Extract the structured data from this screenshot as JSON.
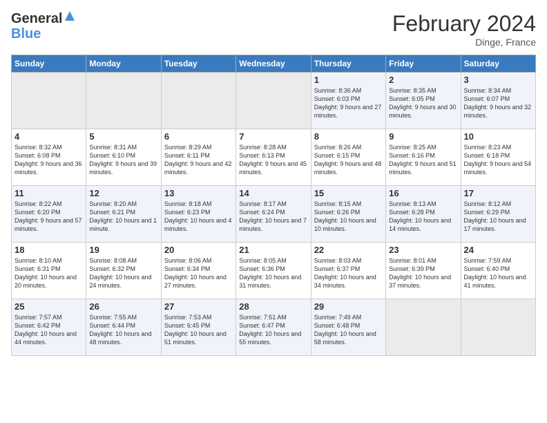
{
  "header": {
    "logo_line1": "General",
    "logo_line2": "Blue",
    "title": "February 2024",
    "subtitle": "Dinge, France"
  },
  "weekdays": [
    "Sunday",
    "Monday",
    "Tuesday",
    "Wednesday",
    "Thursday",
    "Friday",
    "Saturday"
  ],
  "weeks": [
    [
      {
        "day": "",
        "info": ""
      },
      {
        "day": "",
        "info": ""
      },
      {
        "day": "",
        "info": ""
      },
      {
        "day": "",
        "info": ""
      },
      {
        "day": "1",
        "info": "Sunrise: 8:36 AM\nSunset: 6:03 PM\nDaylight: 9 hours and 27 minutes."
      },
      {
        "day": "2",
        "info": "Sunrise: 8:35 AM\nSunset: 6:05 PM\nDaylight: 9 hours and 30 minutes."
      },
      {
        "day": "3",
        "info": "Sunrise: 8:34 AM\nSunset: 6:07 PM\nDaylight: 9 hours and 32 minutes."
      }
    ],
    [
      {
        "day": "4",
        "info": "Sunrise: 8:32 AM\nSunset: 6:08 PM\nDaylight: 9 hours and 36 minutes."
      },
      {
        "day": "5",
        "info": "Sunrise: 8:31 AM\nSunset: 6:10 PM\nDaylight: 9 hours and 39 minutes."
      },
      {
        "day": "6",
        "info": "Sunrise: 8:29 AM\nSunset: 6:11 PM\nDaylight: 9 hours and 42 minutes."
      },
      {
        "day": "7",
        "info": "Sunrise: 8:28 AM\nSunset: 6:13 PM\nDaylight: 9 hours and 45 minutes."
      },
      {
        "day": "8",
        "info": "Sunrise: 8:26 AM\nSunset: 6:15 PM\nDaylight: 9 hours and 48 minutes."
      },
      {
        "day": "9",
        "info": "Sunrise: 8:25 AM\nSunset: 6:16 PM\nDaylight: 9 hours and 51 minutes."
      },
      {
        "day": "10",
        "info": "Sunrise: 8:23 AM\nSunset: 6:18 PM\nDaylight: 9 hours and 54 minutes."
      }
    ],
    [
      {
        "day": "11",
        "info": "Sunrise: 8:22 AM\nSunset: 6:20 PM\nDaylight: 9 hours and 57 minutes."
      },
      {
        "day": "12",
        "info": "Sunrise: 8:20 AM\nSunset: 6:21 PM\nDaylight: 10 hours and 1 minute."
      },
      {
        "day": "13",
        "info": "Sunrise: 8:18 AM\nSunset: 6:23 PM\nDaylight: 10 hours and 4 minutes."
      },
      {
        "day": "14",
        "info": "Sunrise: 8:17 AM\nSunset: 6:24 PM\nDaylight: 10 hours and 7 minutes."
      },
      {
        "day": "15",
        "info": "Sunrise: 8:15 AM\nSunset: 6:26 PM\nDaylight: 10 hours and 10 minutes."
      },
      {
        "day": "16",
        "info": "Sunrise: 8:13 AM\nSunset: 6:28 PM\nDaylight: 10 hours and 14 minutes."
      },
      {
        "day": "17",
        "info": "Sunrise: 8:12 AM\nSunset: 6:29 PM\nDaylight: 10 hours and 17 minutes."
      }
    ],
    [
      {
        "day": "18",
        "info": "Sunrise: 8:10 AM\nSunset: 6:31 PM\nDaylight: 10 hours and 20 minutes."
      },
      {
        "day": "19",
        "info": "Sunrise: 8:08 AM\nSunset: 6:32 PM\nDaylight: 10 hours and 24 minutes."
      },
      {
        "day": "20",
        "info": "Sunrise: 8:06 AM\nSunset: 6:34 PM\nDaylight: 10 hours and 27 minutes."
      },
      {
        "day": "21",
        "info": "Sunrise: 8:05 AM\nSunset: 6:36 PM\nDaylight: 10 hours and 31 minutes."
      },
      {
        "day": "22",
        "info": "Sunrise: 8:03 AM\nSunset: 6:37 PM\nDaylight: 10 hours and 34 minutes."
      },
      {
        "day": "23",
        "info": "Sunrise: 8:01 AM\nSunset: 6:39 PM\nDaylight: 10 hours and 37 minutes."
      },
      {
        "day": "24",
        "info": "Sunrise: 7:59 AM\nSunset: 6:40 PM\nDaylight: 10 hours and 41 minutes."
      }
    ],
    [
      {
        "day": "25",
        "info": "Sunrise: 7:57 AM\nSunset: 6:42 PM\nDaylight: 10 hours and 44 minutes."
      },
      {
        "day": "26",
        "info": "Sunrise: 7:55 AM\nSunset: 6:44 PM\nDaylight: 10 hours and 48 minutes."
      },
      {
        "day": "27",
        "info": "Sunrise: 7:53 AM\nSunset: 6:45 PM\nDaylight: 10 hours and 51 minutes."
      },
      {
        "day": "28",
        "info": "Sunrise: 7:51 AM\nSunset: 6:47 PM\nDaylight: 10 hours and 55 minutes."
      },
      {
        "day": "29",
        "info": "Sunrise: 7:49 AM\nSunset: 6:48 PM\nDaylight: 10 hours and 58 minutes."
      },
      {
        "day": "",
        "info": ""
      },
      {
        "day": "",
        "info": ""
      }
    ]
  ]
}
